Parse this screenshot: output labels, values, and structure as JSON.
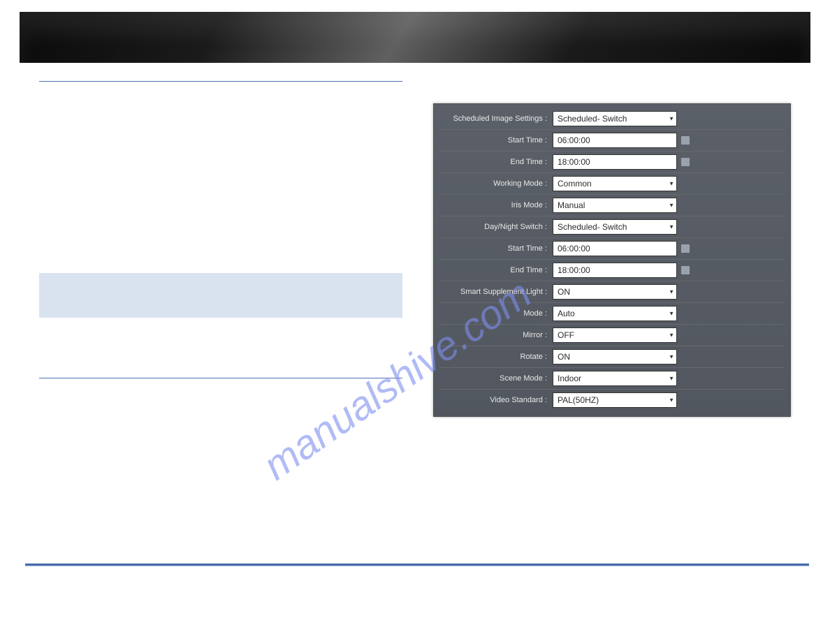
{
  "watermark": "manualshive.com",
  "settings": {
    "rows": [
      {
        "label": "Scheduled Image Settings :",
        "type": "select",
        "value": "Scheduled- Switch"
      },
      {
        "label": "Start Time :",
        "type": "time",
        "value": "06:00:00"
      },
      {
        "label": "End Time :",
        "type": "time",
        "value": "18:00:00"
      },
      {
        "label": "Working Mode :",
        "type": "select",
        "value": "Common"
      },
      {
        "label": "Iris Mode :",
        "type": "select",
        "value": "Manual"
      },
      {
        "label": "Day/Night Switch :",
        "type": "select",
        "value": "Scheduled- Switch"
      },
      {
        "label": "Start Time :",
        "type": "time",
        "value": "06:00:00"
      },
      {
        "label": "End Time :",
        "type": "time",
        "value": "18:00:00"
      },
      {
        "label": "Smart Supplement Light :",
        "type": "select",
        "value": "ON"
      },
      {
        "label": "Mode :",
        "type": "select",
        "value": "Auto"
      },
      {
        "label": "Mirror :",
        "type": "select",
        "value": "OFF"
      },
      {
        "label": "Rotate :",
        "type": "select",
        "value": "ON"
      },
      {
        "label": "Scene Mode :",
        "type": "select",
        "value": "Indoor"
      },
      {
        "label": "Video Standard :",
        "type": "select",
        "value": "PAL(50HZ)"
      }
    ]
  }
}
